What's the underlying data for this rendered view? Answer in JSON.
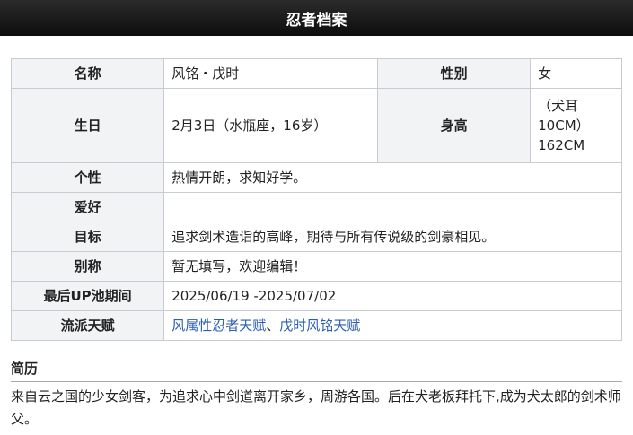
{
  "header": {
    "title": "忍者档案"
  },
  "profile": {
    "name_label": "名称",
    "name_value": "风铭・戊时",
    "sex_label": "性别",
    "sex_value": "女",
    "birthday_label": "生日",
    "birthday_value": "2月3日（水瓶座，16岁）",
    "height_label": "身高",
    "height_value_line1": "（犬耳",
    "height_value_line2": "10CM）",
    "height_value_line3": "162CM",
    "personality_label": "个性",
    "personality_value": "热情开朗，求知好学。",
    "hobby_label": "爱好",
    "hobby_value": "",
    "goal_label": "目标",
    "goal_value": "追求剑术造诣的高峰，期待与所有传说级的剑豪相见。",
    "alias_label": "别称",
    "alias_value": "暂无填写，欢迎编辑！",
    "pool_label": "最后UP池期间",
    "pool_value": "2025/06/19 -2025/07/02",
    "talent_label": "流派天赋",
    "talent_link1": "风属性忍者天赋",
    "talent_sep": "、",
    "talent_link2": "戊时风铭天赋"
  },
  "bio": {
    "title": "简历",
    "text": "来自云之国的少女剑客，为追求心中剑道离开家乡，周游各国。后在犬老板拜托下,成为犬太郎的剑术师父。"
  }
}
